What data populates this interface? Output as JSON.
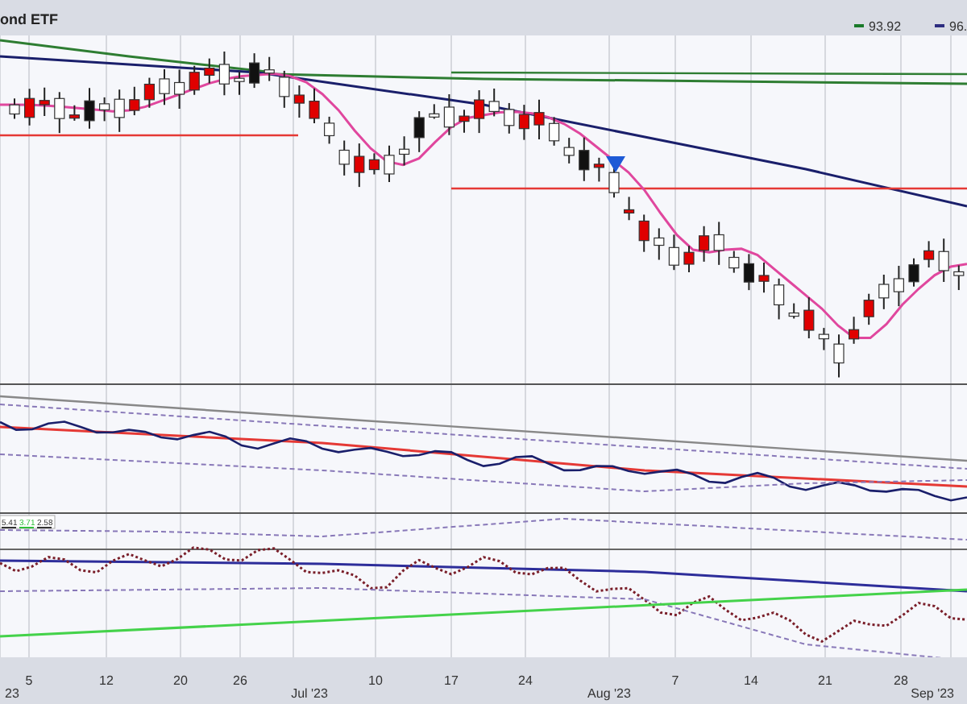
{
  "header": {
    "title": "ond ETF"
  },
  "price_labels": [
    "93.92",
    "96."
  ],
  "indicator_legend": [
    {
      "label": "5.41",
      "color": "#333333"
    },
    {
      "label": "3.71",
      "color": "#2fbf3a"
    },
    {
      "label": "2.58",
      "color": "#333333"
    }
  ],
  "x_axis": [
    {
      "label": "23",
      "kind": "month"
    },
    {
      "label": "5",
      "kind": "day"
    },
    {
      "label": "12",
      "kind": "day"
    },
    {
      "label": "20",
      "kind": "day"
    },
    {
      "label": "26",
      "kind": "day"
    },
    {
      "label": "Jul '23",
      "kind": "month"
    },
    {
      "label": "10",
      "kind": "day"
    },
    {
      "label": "17",
      "kind": "day"
    },
    {
      "label": "24",
      "kind": "day"
    },
    {
      "label": "Aug '23",
      "kind": "month"
    },
    {
      "label": "7",
      "kind": "day"
    },
    {
      "label": "14",
      "kind": "day"
    },
    {
      "label": "21",
      "kind": "day"
    },
    {
      "label": "28",
      "kind": "day"
    },
    {
      "label": "Sep '23",
      "kind": "month"
    }
  ]
}
